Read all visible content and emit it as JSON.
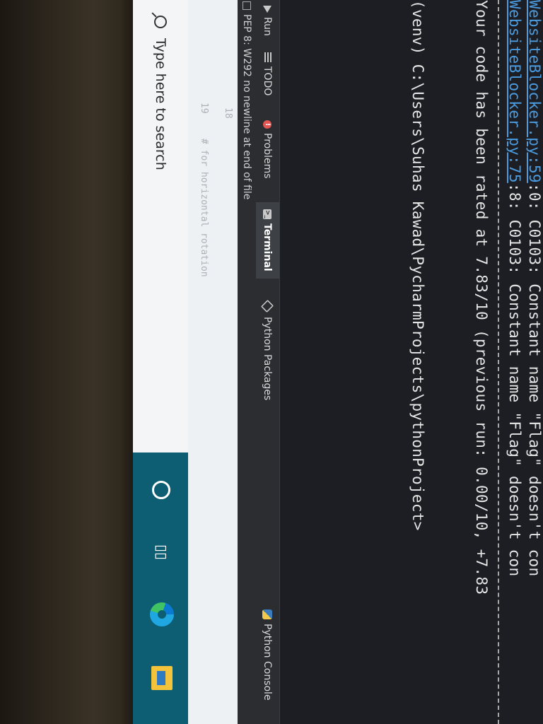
{
  "terminal": {
    "lines": [
      {
        "file": "WebsiteBlocker.py:59",
        "rest": ":0: C0103: Constant name \"Flag\" doesn't con"
      },
      {
        "file": "WebsiteBlocker.py:75",
        "rest": ":8: C0103: Constant name \"Flag\" doesn't con"
      }
    ],
    "rating": "Your code has been rated at 7.83/10 (previous run: 0.00/10, +7.83",
    "prompt": "(venv) C:\\Users\\Suhas Kawad\\PycharmProjects\\pythonProject>"
  },
  "tool_tabs": [
    {
      "label": "Run",
      "icon": "run-icon"
    },
    {
      "label": "TODO",
      "icon": "todo-icon"
    },
    {
      "label": "Problems",
      "icon": "problems-icon"
    },
    {
      "label": "Terminal",
      "icon": "terminal-icon"
    },
    {
      "label": "Python Packages",
      "icon": "python-packages-icon"
    },
    {
      "label": "Python Console",
      "icon": "python-console-icon"
    }
  ],
  "status": {
    "message": "PEP 8: W292 no newline at end of file"
  },
  "editor": {
    "line_18": "18",
    "line_19": "19",
    "line_19_text": "# for horizontal rotation"
  },
  "taskbar": {
    "search_placeholder": "Type here to search"
  }
}
